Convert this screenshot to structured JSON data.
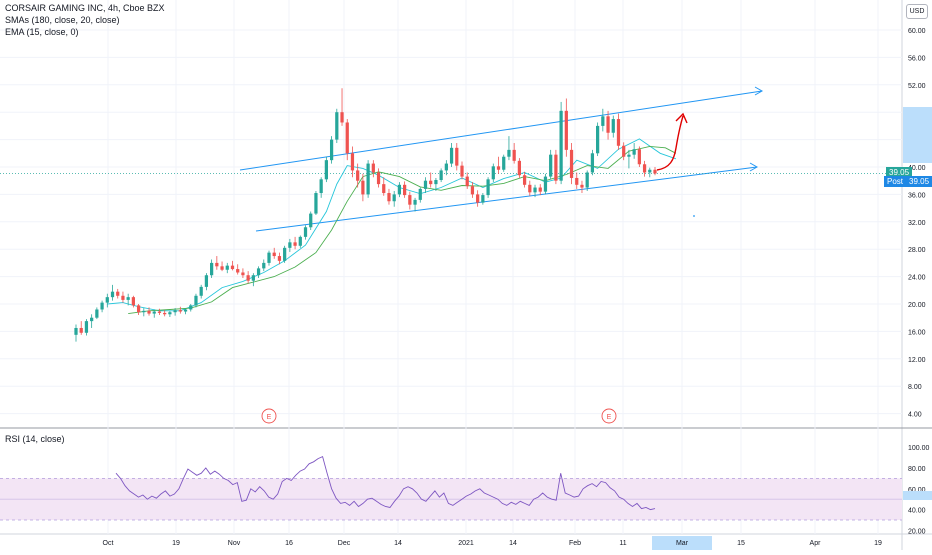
{
  "header": {
    "symbol_title": "CORSAIR GAMING INC, 4h, Cboe BZX",
    "sma_legend": "SMAs (180, close, 20, close)",
    "ema_legend": "EMA (15, close, 0)",
    "rsi_legend": "RSI (14, close)",
    "currency": "USD"
  },
  "price_tags": {
    "last": "39.05",
    "post_label": "Post",
    "post_value": "39.05"
  },
  "events": [
    "E",
    "E"
  ],
  "colors": {
    "up": "#26a69a",
    "down": "#ef5350",
    "channel": "#2196f3",
    "sma_slow": "#4caf50",
    "sma_fast": "#2196f3",
    "ema": "#26c6da",
    "rsi_line": "#7e57c2",
    "rsi_band": "#f3e5f5",
    "arrow": "#e00000"
  },
  "chart_data": [
    {
      "type": "candlestick",
      "title": "CORSAIR GAMING INC, 4h, Cboe BZX",
      "ylim": [
        2,
        62
      ],
      "y_ticks": [
        4,
        8,
        12,
        16,
        20,
        24,
        28,
        32,
        36,
        40,
        44,
        48,
        52,
        56,
        60
      ],
      "y_tick_labels": [
        "4.00",
        "8.00",
        "12.00",
        "16.00",
        "20.00",
        "24.00",
        "28.00",
        "32.00",
        "36.00",
        "40.00",
        "44.00",
        "48.00",
        "52.00",
        "56.00",
        "60.00"
      ],
      "x_ticks": [
        "Oct",
        "19",
        "Nov",
        "16",
        "Dec",
        "14",
        "2021",
        "14",
        "Feb",
        "11",
        "Mar",
        "15",
        "Apr",
        "19"
      ],
      "candles": [
        [
          15.5,
          17.0,
          14.5,
          16.5
        ],
        [
          16.5,
          17.5,
          15.5,
          15.8
        ],
        [
          15.8,
          17.8,
          15.4,
          17.5
        ],
        [
          17.5,
          18.5,
          16.5,
          18.0
        ],
        [
          18.0,
          19.5,
          17.8,
          19.2
        ],
        [
          19.2,
          20.5,
          18.8,
          20.2
        ],
        [
          20.2,
          21.5,
          19.5,
          21.0
        ],
        [
          21.0,
          22.8,
          20.5,
          21.8
        ],
        [
          21.8,
          22.2,
          20.8,
          21.2
        ],
        [
          21.2,
          21.8,
          20.2,
          20.6
        ],
        [
          20.6,
          21.5,
          19.8,
          21.0
        ],
        [
          21.0,
          21.2,
          19.5,
          19.8
        ],
        [
          19.8,
          20.0,
          18.4,
          18.8
        ],
        [
          18.8,
          19.4,
          18.2,
          19.0
        ],
        [
          19.0,
          19.5,
          18.3,
          18.6
        ],
        [
          18.6,
          19.2,
          18.0,
          18.9
        ],
        [
          18.9,
          19.3,
          18.4,
          18.7
        ],
        [
          18.7,
          19.1,
          18.2,
          18.5
        ],
        [
          18.5,
          19.0,
          18.1,
          18.8
        ],
        [
          18.8,
          19.4,
          18.3,
          19.1
        ],
        [
          19.1,
          19.6,
          18.6,
          18.9
        ],
        [
          18.9,
          19.3,
          18.5,
          19.2
        ],
        [
          19.2,
          20.0,
          18.9,
          19.8
        ],
        [
          19.8,
          21.5,
          19.5,
          21.2
        ],
        [
          21.2,
          22.8,
          20.8,
          22.5
        ],
        [
          22.5,
          24.5,
          22.0,
          24.2
        ],
        [
          24.2,
          26.5,
          23.8,
          26.0
        ],
        [
          26.0,
          27.0,
          25.0,
          25.5
        ],
        [
          25.5,
          26.2,
          24.8,
          25.0
        ],
        [
          25.0,
          26.0,
          24.5,
          25.6
        ],
        [
          25.6,
          26.3,
          24.9,
          25.1
        ],
        [
          25.1,
          25.8,
          24.3,
          24.6
        ],
        [
          24.6,
          25.2,
          23.8,
          24.2
        ],
        [
          24.2,
          24.8,
          23.0,
          23.4
        ],
        [
          23.4,
          24.5,
          22.6,
          24.2
        ],
        [
          24.2,
          25.5,
          23.8,
          25.2
        ],
        [
          25.2,
          26.5,
          24.8,
          26.0
        ],
        [
          26.0,
          27.8,
          25.6,
          27.5
        ],
        [
          27.5,
          28.2,
          26.6,
          27.0
        ],
        [
          27.0,
          27.5,
          25.8,
          26.3
        ],
        [
          26.3,
          28.5,
          26.0,
          28.2
        ],
        [
          28.2,
          29.5,
          27.6,
          29.0
        ],
        [
          29.0,
          29.8,
          28.0,
          28.5
        ],
        [
          28.5,
          30.0,
          28.2,
          29.8
        ],
        [
          29.8,
          31.5,
          29.4,
          31.2
        ],
        [
          31.2,
          33.5,
          30.8,
          33.2
        ],
        [
          33.2,
          36.5,
          33.0,
          36.2
        ],
        [
          36.2,
          38.5,
          35.5,
          38.2
        ],
        [
          38.2,
          41.5,
          37.8,
          41.0
        ],
        [
          41.0,
          44.5,
          40.5,
          44.0
        ],
        [
          44.0,
          48.5,
          43.5,
          48.0
        ],
        [
          48.0,
          51.5,
          46.0,
          46.5
        ],
        [
          46.5,
          47.0,
          41.0,
          42.0
        ],
        [
          42.0,
          43.0,
          38.5,
          39.5
        ],
        [
          39.5,
          40.5,
          37.0,
          38.0
        ],
        [
          38.0,
          39.0,
          35.0,
          36.0
        ],
        [
          36.0,
          41.0,
          35.5,
          40.5
        ],
        [
          40.5,
          41.0,
          38.5,
          39.2
        ],
        [
          39.2,
          39.8,
          37.0,
          37.5
        ],
        [
          37.5,
          38.5,
          35.8,
          36.2
        ],
        [
          36.2,
          36.8,
          34.5,
          35.0
        ],
        [
          35.0,
          36.5,
          34.2,
          36.0
        ],
        [
          36.0,
          37.8,
          35.6,
          37.4
        ],
        [
          37.4,
          37.9,
          35.5,
          35.9
        ],
        [
          35.9,
          36.4,
          33.8,
          34.5
        ],
        [
          34.5,
          35.5,
          33.5,
          35.2
        ],
        [
          35.2,
          37.0,
          34.8,
          36.8
        ],
        [
          36.8,
          38.5,
          36.2,
          38.0
        ],
        [
          38.0,
          39.2,
          37.0,
          37.5
        ],
        [
          37.5,
          38.4,
          36.5,
          38.1
        ],
        [
          38.1,
          39.8,
          37.8,
          39.5
        ],
        [
          39.5,
          41.0,
          38.8,
          40.5
        ],
        [
          40.5,
          43.5,
          40.0,
          42.8
        ],
        [
          42.8,
          43.5,
          39.5,
          40.2
        ],
        [
          40.2,
          40.8,
          38.2,
          38.6
        ],
        [
          38.6,
          39.2,
          36.8,
          37.2
        ],
        [
          37.2,
          37.8,
          35.5,
          36.0
        ],
        [
          36.0,
          36.6,
          34.2,
          34.8
        ],
        [
          34.8,
          36.2,
          34.5,
          35.9
        ],
        [
          35.9,
          38.5,
          35.5,
          38.2
        ],
        [
          38.2,
          40.5,
          37.8,
          40.1
        ],
        [
          40.1,
          41.5,
          39.0,
          39.6
        ],
        [
          39.6,
          41.8,
          39.3,
          41.5
        ],
        [
          41.5,
          44.5,
          41.0,
          42.5
        ],
        [
          42.5,
          43.5,
          40.5,
          40.9
        ],
        [
          40.9,
          41.3,
          38.4,
          38.8
        ],
        [
          38.8,
          39.3,
          37.0,
          37.4
        ],
        [
          37.4,
          38.0,
          35.8,
          36.3
        ],
        [
          36.3,
          37.4,
          35.6,
          37.0
        ],
        [
          37.0,
          37.5,
          35.9,
          36.4
        ],
        [
          36.4,
          39.0,
          36.0,
          38.6
        ],
        [
          38.6,
          42.5,
          38.2,
          41.8
        ],
        [
          41.8,
          42.5,
          37.5,
          38.0
        ],
        [
          38.0,
          49.5,
          37.5,
          48.2
        ],
        [
          48.2,
          50.0,
          41.5,
          42.5
        ],
        [
          42.5,
          43.5,
          37.5,
          38.4
        ],
        [
          38.4,
          39.2,
          36.8,
          37.4
        ],
        [
          37.4,
          38.0,
          36.2,
          37.0
        ],
        [
          37.0,
          39.5,
          36.5,
          39.2
        ],
        [
          39.2,
          42.5,
          38.8,
          42.0
        ],
        [
          42.0,
          46.5,
          41.6,
          46.0
        ],
        [
          46.0,
          48.5,
          45.2,
          47.4
        ],
        [
          47.4,
          48.2,
          44.0,
          45.0
        ],
        [
          45.0,
          47.5,
          44.3,
          47.0
        ],
        [
          47.0,
          47.8,
          42.5,
          43.1
        ],
        [
          43.1,
          43.6,
          41.0,
          41.5
        ],
        [
          41.5,
          42.5,
          39.8,
          41.8
        ],
        [
          41.8,
          43.5,
          41.2,
          42.6
        ],
        [
          42.6,
          43.0,
          40.0,
          40.4
        ],
        [
          40.4,
          40.9,
          38.6,
          39.2
        ],
        [
          39.2,
          39.9,
          38.5,
          39.6
        ],
        [
          39.6,
          40.0,
          38.8,
          39.05
        ]
      ],
      "series": [
        {
          "name": "EMA (15, close, 0)",
          "color": "#26c6da",
          "values": [
            [
              6,
              20.0
            ],
            [
              9,
              20.2
            ],
            [
              12,
              19.6
            ],
            [
              16,
              19.0
            ],
            [
              20,
              19.0
            ],
            [
              24,
              20.2
            ],
            [
              28,
              22.4
            ],
            [
              32,
              23.3
            ],
            [
              36,
              24.6
            ],
            [
              40,
              26.3
            ],
            [
              44,
              28.6
            ],
            [
              48,
              33.5
            ],
            [
              50,
              37.5
            ],
            [
              52,
              40.2
            ],
            [
              55,
              39.8
            ],
            [
              58,
              38.8
            ],
            [
              62,
              37.0
            ],
            [
              66,
              36.1
            ],
            [
              70,
              37.0
            ],
            [
              74,
              38.4
            ],
            [
              78,
              37.0
            ],
            [
              82,
              38.3
            ],
            [
              86,
              39.2
            ],
            [
              90,
              37.8
            ],
            [
              93,
              38.4
            ],
            [
              96,
              41.0
            ],
            [
              100,
              39.8
            ],
            [
              104,
              42.6
            ],
            [
              108,
              44.1
            ],
            [
              112,
              42.0
            ],
            [
              115,
              41.2
            ]
          ]
        },
        {
          "name": "SMA 20",
          "color": "#4caf50",
          "values": [
            [
              10,
              18.6
            ],
            [
              14,
              19.0
            ],
            [
              18,
              19.2
            ],
            [
              22,
              19.4
            ],
            [
              26,
              20.3
            ],
            [
              30,
              22.4
            ],
            [
              34,
              23.2
            ],
            [
              38,
              24.0
            ],
            [
              42,
              25.4
            ],
            [
              46,
              27.5
            ],
            [
              49,
              30.8
            ],
            [
              52,
              35.0
            ],
            [
              55,
              38.6
            ],
            [
              58,
              39.3
            ],
            [
              62,
              38.6
            ],
            [
              66,
              37.1
            ],
            [
              70,
              36.6
            ],
            [
              74,
              37.3
            ],
            [
              78,
              37.2
            ],
            [
              82,
              37.6
            ],
            [
              86,
              38.6
            ],
            [
              90,
              38.0
            ],
            [
              94,
              38.9
            ],
            [
              98,
              40.2
            ],
            [
              102,
              39.8
            ],
            [
              106,
              42.3
            ],
            [
              110,
              43.0
            ],
            [
              113,
              42.8
            ],
            [
              115,
              42.0
            ]
          ]
        }
      ]
    },
    {
      "type": "line",
      "title": "RSI (14, close)",
      "ylim": [
        10,
        108
      ],
      "y_ticks": [
        20,
        40,
        60,
        80,
        100
      ],
      "y_tick_labels": [
        "20.00",
        "40.00",
        "60.00",
        "80.00",
        "100.00"
      ],
      "band": [
        30,
        70
      ],
      "series": [
        {
          "name": "RSI (14, close)",
          "values": [
            75,
            70,
            63,
            58,
            55,
            52,
            54,
            50,
            53,
            51,
            55,
            58,
            53,
            55,
            60,
            70,
            79,
            76,
            73,
            75,
            80,
            74,
            77,
            74,
            70,
            68,
            64,
            66,
            48,
            49,
            60,
            57,
            62,
            58,
            52,
            50,
            55,
            67,
            70,
            68,
            73,
            77,
            79,
            84,
            86,
            89,
            91,
            75,
            60,
            51,
            46,
            47,
            44,
            48,
            43,
            46,
            50,
            51,
            48,
            45,
            43,
            42,
            48,
            53,
            60,
            62,
            60,
            56,
            50,
            48,
            53,
            58,
            52,
            56,
            46,
            44,
            47,
            50,
            53,
            55,
            58,
            60,
            56,
            54,
            52,
            50,
            46,
            44,
            47,
            45,
            48,
            46,
            44,
            50,
            52,
            56,
            52,
            50,
            49,
            75,
            56,
            54,
            52,
            53,
            60,
            63,
            65,
            62,
            67,
            66,
            61,
            58,
            52,
            50,
            46,
            43,
            46,
            41,
            42,
            40,
            41
          ]
        }
      ]
    }
  ]
}
